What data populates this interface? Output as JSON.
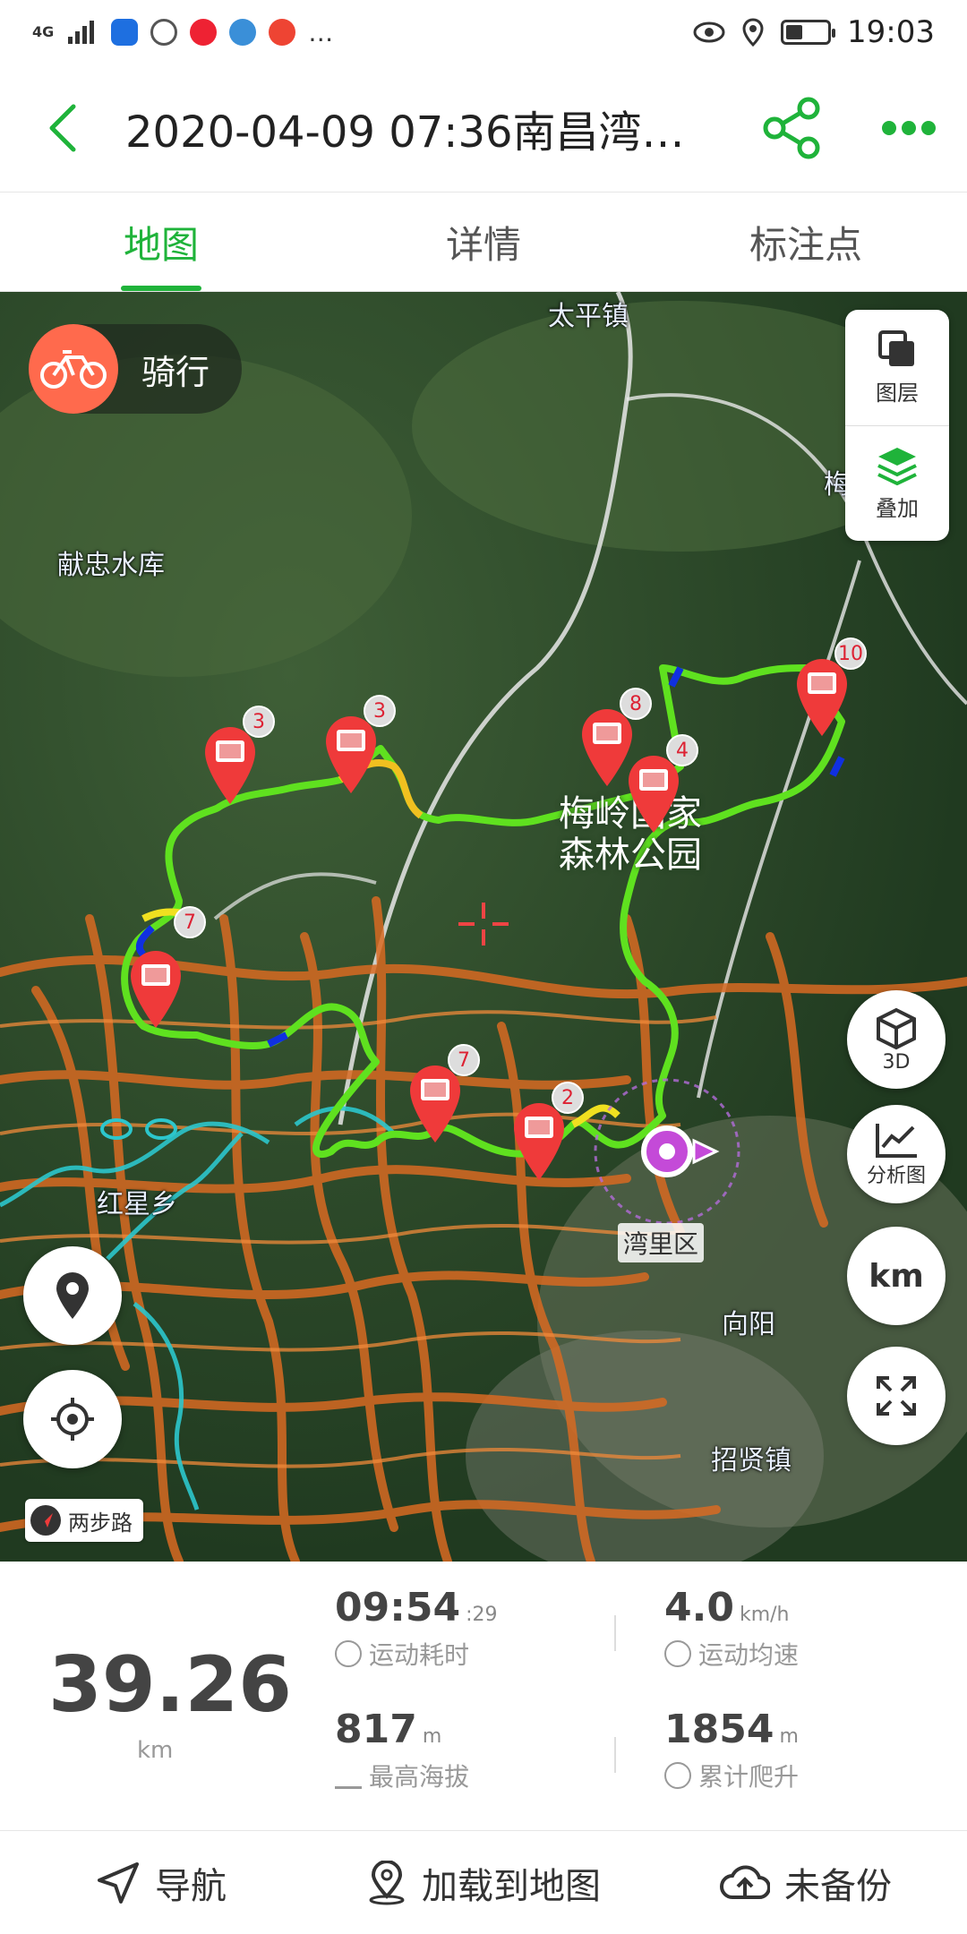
{
  "status_bar": {
    "network": "4G",
    "time": "19:03"
  },
  "header": {
    "title": "2020-04-09 07:36南昌湾…"
  },
  "tabs": [
    {
      "label": "地图",
      "active": true
    },
    {
      "label": "详情",
      "active": false
    },
    {
      "label": "标注点",
      "active": false
    }
  ],
  "map": {
    "sport_type": "骑行",
    "layer_panel": {
      "layers_label": "图层",
      "overlay_label": "叠加"
    },
    "labels": {
      "taiping": "太平镇",
      "xianzhong": "献忠水库",
      "meiling_1": "梅岭国家",
      "meiling_2": "森林公园",
      "hongxing": "红星乡",
      "wanli": "湾里区",
      "xiangyang": "向阳",
      "zhaoxian": "招贤镇",
      "edge": "梅"
    },
    "buttons": {
      "3d": "3D",
      "analysis": "分析图",
      "km": "km"
    },
    "pins": [
      {
        "count": "3"
      },
      {
        "count": "3"
      },
      {
        "count": "8"
      },
      {
        "count": "4"
      },
      {
        "count": "10"
      },
      {
        "count": "7"
      },
      {
        "count": "7"
      },
      {
        "count": "2"
      }
    ],
    "two_step": "两步路",
    "colors": {
      "track_green": "#5fe11f",
      "roads_orange": "#d86a22",
      "water_cyan": "#2cc6cc"
    }
  },
  "stats": {
    "distance": "39.26",
    "distance_unit": "km",
    "duration": "09:54",
    "duration_seconds": ":29",
    "duration_label": "运动耗时",
    "avg_speed": "4.0",
    "avg_speed_unit": "km/h",
    "avg_speed_label": "运动均速",
    "max_alt": "817",
    "max_alt_unit": "m",
    "max_alt_label": "最高海拔",
    "climb": "1854",
    "climb_unit": "m",
    "climb_label": "累计爬升"
  },
  "bottom": {
    "navigate": "导航",
    "load_map": "加载到地图",
    "backup": "未备份"
  },
  "accent_color": "#1fb33a"
}
